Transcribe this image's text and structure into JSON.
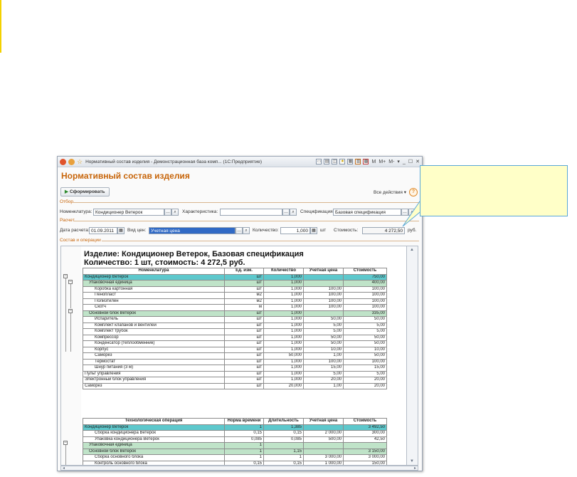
{
  "window": {
    "title": "Нормативный состав изделия - Демонстрационная база комп... (1С:Предприятие)",
    "toolbar_icons": [
      "save-icon",
      "print-icon",
      "preview-icon",
      "favorite-icon",
      "calendar-icon",
      "table-icon",
      "calculator-icon"
    ],
    "memory_buttons": [
      "M",
      "M+",
      "M-"
    ]
  },
  "form": {
    "title": "Нормативный состав изделия",
    "generate_button": "Сформировать",
    "all_actions": "Все действия ▾",
    "sections": {
      "filter": "Отбор",
      "calc": "Расчет",
      "composition": "Состав и операции"
    }
  },
  "filter": {
    "nomenclature_label": "Номенклатура:",
    "nomenclature_value": "Кондиционер Ветерок",
    "characteristic_label": "Характеристика:",
    "characteristic_value": "",
    "specification_label": "Спецификация:",
    "specification_value": "Базовая спецификация"
  },
  "calc": {
    "date_label": "Дата расчета:",
    "date_value": "01.09.2011",
    "price_type_label": "Вид цен:",
    "price_type_value": "Учетная цена",
    "quantity_label": "Количество:",
    "quantity_value": "1,000",
    "unit": "шт",
    "cost_label": "Стоимость:",
    "cost_value": "4 272,50",
    "currency": "руб."
  },
  "report": {
    "heading1": "Изделие: Кондиционер Ветерок, Базовая спецификация",
    "heading2": "Количество: 1 шт, стоимость: 4 272,5 руб.",
    "materials": {
      "headers": [
        "Номенклатура",
        "Ед. изм.",
        "Количество",
        "Учетная цена",
        "Стоимость"
      ],
      "rows": [
        {
          "name": "Кондиционер Ветерок",
          "unit": "шт",
          "qty": "1,000",
          "price": "",
          "cost": "750,00",
          "level": 0
        },
        {
          "name": "Упаковочная единица",
          "unit": "шт",
          "qty": "1,000",
          "price": "",
          "cost": "400,00",
          "level": 1
        },
        {
          "name": "Коробка картонная",
          "unit": "шт",
          "qty": "1,000",
          "price": "100,00",
          "cost": "100,00",
          "level": 2
        },
        {
          "name": "Пенопласт",
          "unit": "м2",
          "qty": "1,000",
          "price": "100,00",
          "cost": "100,00",
          "level": 2
        },
        {
          "name": "Полиэтилен",
          "unit": "м2",
          "qty": "1,000",
          "price": "100,00",
          "cost": "100,00",
          "level": 2
        },
        {
          "name": "Скотч",
          "unit": "м",
          "qty": "1,000",
          "price": "100,00",
          "cost": "100,00",
          "level": 2
        },
        {
          "name": "Основной блок Ветерок",
          "unit": "шт",
          "qty": "1,000",
          "price": "",
          "cost": "335,00",
          "level": 1
        },
        {
          "name": "Испаритель",
          "unit": "шт",
          "qty": "1,000",
          "price": "50,00",
          "cost": "50,00",
          "level": 2
        },
        {
          "name": "Комплект клапанов и вентилей",
          "unit": "шт",
          "qty": "1,000",
          "price": "5,00",
          "cost": "5,00",
          "level": 2
        },
        {
          "name": "Комплект трубок",
          "unit": "шт",
          "qty": "1,000",
          "price": "5,00",
          "cost": "5,00",
          "level": 2
        },
        {
          "name": "Компрессор",
          "unit": "шт",
          "qty": "1,000",
          "price": "50,00",
          "cost": "50,00",
          "level": 2
        },
        {
          "name": "Конденсатор (теплообменник)",
          "unit": "шт",
          "qty": "1,000",
          "price": "50,00",
          "cost": "50,00",
          "level": 2
        },
        {
          "name": "Корпус",
          "unit": "шт",
          "qty": "1,000",
          "price": "10,00",
          "cost": "10,00",
          "level": 2
        },
        {
          "name": "Саморез",
          "unit": "шт",
          "qty": "50,000",
          "price": "1,00",
          "cost": "50,00",
          "level": 2
        },
        {
          "name": "Термостат",
          "unit": "шт",
          "qty": "1,000",
          "price": "100,00",
          "cost": "100,00",
          "level": 2
        },
        {
          "name": "Шнур питания (3 м)",
          "unit": "шт",
          "qty": "1,000",
          "price": "15,00",
          "cost": "15,00",
          "level": 2
        },
        {
          "name": "Пульт управления",
          "unit": "шт",
          "qty": "1,000",
          "price": "5,00",
          "cost": "5,00",
          "level": 3
        },
        {
          "name": "Электронный блок управления",
          "unit": "шт",
          "qty": "1,000",
          "price": "20,00",
          "cost": "20,00",
          "level": 3
        },
        {
          "name": "Саморез",
          "unit": "шт",
          "qty": "20,000",
          "price": "1,00",
          "cost": "20,00",
          "level": 3
        }
      ]
    },
    "operations": {
      "headers": [
        "Технологическая операция",
        "Норма времени",
        "Длительность",
        "Учетная цена",
        "Стоимость"
      ],
      "rows": [
        {
          "name": "Кондиционер Ветерок",
          "norm": "1",
          "dur": "1,385",
          "price": "",
          "cost": "3 492,50",
          "level": 0
        },
        {
          "name": "Сборка кондиционера Ветерок",
          "norm": "0,15",
          "dur": "0,15",
          "price": "2 000,00",
          "cost": "300,00",
          "level": 2
        },
        {
          "name": "Упаковка кондиционера Ветерок",
          "norm": "0,085",
          "dur": "0,085",
          "price": "500,00",
          "cost": "42,50",
          "level": 2
        },
        {
          "name": "Упаковочная единица",
          "norm": "1",
          "dur": "",
          "price": "",
          "cost": "",
          "level": 1
        },
        {
          "name": "Основной блок Ветерок",
          "norm": "1",
          "dur": "1,15",
          "price": "",
          "cost": "3 150,00",
          "level": 1
        },
        {
          "name": "Сборка основного блока",
          "norm": "1",
          "dur": "1",
          "price": "3 000,00",
          "cost": "3 000,00",
          "level": 2
        },
        {
          "name": "Контроль основного блока",
          "norm": "0,15",
          "dur": "0,15",
          "price": "1 000,00",
          "cost": "150,00",
          "level": 2
        }
      ]
    }
  },
  "colors": {
    "accent_orange": "#c7650a",
    "total_row": "#5dc8cc",
    "group_row": "#bfe3c8",
    "selection": "#316ac5",
    "callout_fill": "#ffffc8",
    "callout_border": "#5aa8d8",
    "side_bar": "#f3d100"
  }
}
